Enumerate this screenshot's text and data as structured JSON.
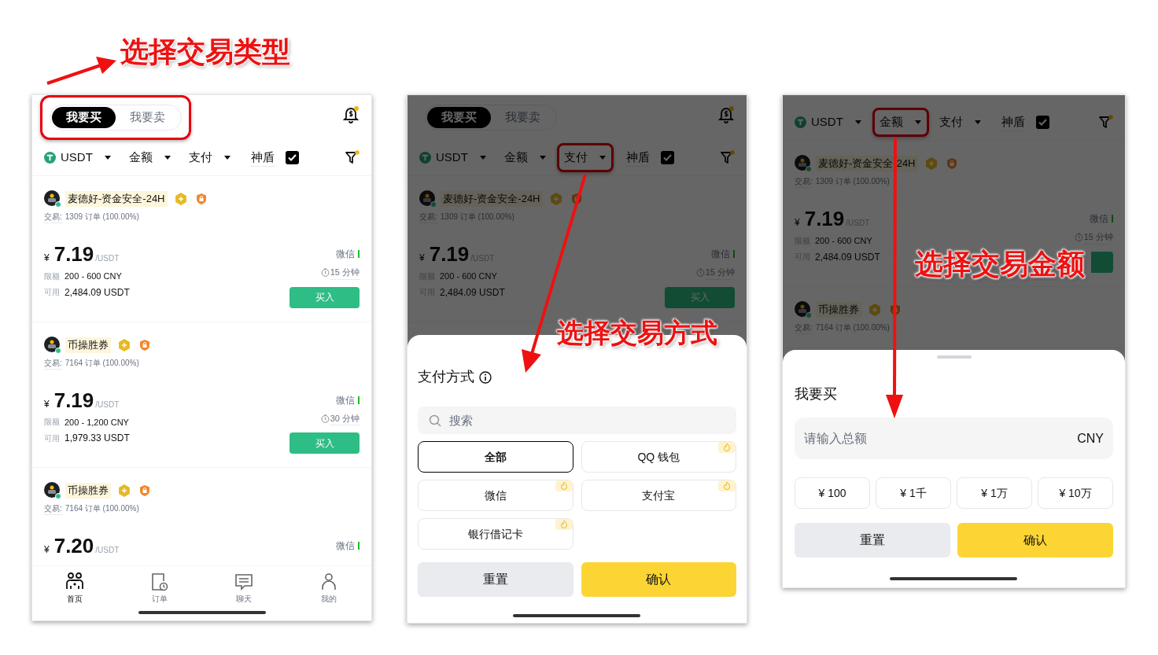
{
  "annotations": [
    {
      "text": "选择交易类型"
    },
    {
      "text": "选择交易方式"
    },
    {
      "text": "选择交易金额"
    }
  ],
  "screens": [
    {
      "tabs": [
        {
          "label": "我要买",
          "selected": true
        },
        {
          "label": "我要卖",
          "selected": false
        }
      ],
      "tabs_marked": true,
      "filters": [
        {
          "label": "USDT",
          "kind": "coin",
          "marked": false
        },
        {
          "label": "金额",
          "kind": "plain",
          "marked": false
        },
        {
          "label": "支付",
          "kind": "plain",
          "marked": false
        }
      ],
      "shield": {
        "label": "神盾",
        "checked": true
      },
      "ads": [
        {
          "merchant": "麦德好-资金安全-24H",
          "trades_label": "交易:",
          "trades": "1309 订单 (100.00%)",
          "currency": "¥",
          "price": "7.19",
          "unit": "/USDT",
          "limit_label": "限额",
          "limit": "200 - 600 CNY",
          "available_label": "可用",
          "available": "2,484.09 USDT",
          "payment": "微信",
          "time": "15 分钟",
          "has_buy_button": true,
          "buy": "买入"
        },
        {
          "merchant": "币操胜券",
          "trades_label": "交易:",
          "trades": "7164 订单 (100.00%)",
          "currency": "¥",
          "price": "7.19",
          "unit": "/USDT",
          "limit_label": "限额",
          "limit": "200 - 1,200 CNY",
          "available_label": "可用",
          "available": "1,979.33 USDT",
          "payment": "微信",
          "time": "30 分钟",
          "has_buy_button": true,
          "buy": "买入"
        },
        {
          "merchant": "币操胜券",
          "trades_label": "交易:",
          "trades": "7164 订单 (100.00%)",
          "currency": "¥",
          "price": "7.20",
          "unit": "/USDT",
          "payment": "微信"
        }
      ],
      "nav": [
        {
          "label": "首页",
          "selected": true
        },
        {
          "label": "订单",
          "selected": false
        },
        {
          "label": "聊天",
          "selected": false
        },
        {
          "label": "我的",
          "selected": false
        }
      ]
    },
    {
      "tabs": [
        {
          "label": "我要买",
          "selected": true
        },
        {
          "label": "我要卖",
          "selected": false
        }
      ],
      "tabs_marked": false,
      "filters": [
        {
          "label": "USDT",
          "kind": "coin",
          "marked": false
        },
        {
          "label": "金额",
          "kind": "plain",
          "marked": false
        },
        {
          "label": "支付",
          "kind": "plain",
          "marked": true
        }
      ],
      "shield": {
        "label": "神盾",
        "checked": true
      },
      "ads": [
        {
          "merchant": "麦德好-资金安全-24H",
          "trades_label": "交易:",
          "trades": "1309 订单 (100.00%)",
          "currency": "¥",
          "price": "7.19",
          "unit": "/USDT",
          "limit_label": "限额",
          "limit": "200 - 600 CNY",
          "available_label": "可用",
          "available": "2,484.09 USDT",
          "payment": "微信",
          "time": "15 分钟",
          "has_buy_button": true,
          "buy": "买入"
        }
      ],
      "sheet": {
        "kind": "payment",
        "title": "支付方式",
        "search_placeholder": "搜索",
        "options": [
          {
            "label": "全部",
            "selected": true,
            "hot": false
          },
          {
            "label": "QQ 钱包",
            "selected": false,
            "hot": true
          },
          {
            "label": "微信",
            "selected": false,
            "hot": true
          },
          {
            "label": "支付宝",
            "selected": false,
            "hot": true
          },
          {
            "label": "银行借记卡",
            "selected": false,
            "hot": true
          }
        ],
        "reset": "重置",
        "confirm": "确认"
      }
    },
    {
      "filters": [
        {
          "label": "USDT",
          "kind": "coin",
          "marked": false
        },
        {
          "label": "金额",
          "kind": "plain",
          "marked": true
        },
        {
          "label": "支付",
          "kind": "plain",
          "marked": false
        }
      ],
      "shield": {
        "label": "神盾",
        "checked": true
      },
      "ads": [
        {
          "merchant": "麦德好-资金安全-24H",
          "trades_label": "交易:",
          "trades": "1309 订单 (100.00%)",
          "currency": "¥",
          "price": "7.19",
          "unit": "/USDT",
          "limit_label": "限额",
          "limit": "200 - 600 CNY",
          "available_label": "可用",
          "available": "2,484.09 USDT",
          "payment": "微信",
          "time": "15 分钟",
          "has_buy_button": true
        },
        {
          "merchant": "币操胜券",
          "trades_label": "交易:",
          "trades": "7164 订单 (100.00%)"
        }
      ],
      "sheet": {
        "kind": "amount",
        "title": "我要买",
        "amount_placeholder": "请输入总额",
        "currency": "CNY",
        "quick_amounts": [
          "¥ 100",
          "¥ 1千",
          "¥ 1万",
          "¥ 10万"
        ],
        "reset": "重置",
        "confirm": "确认"
      }
    }
  ]
}
